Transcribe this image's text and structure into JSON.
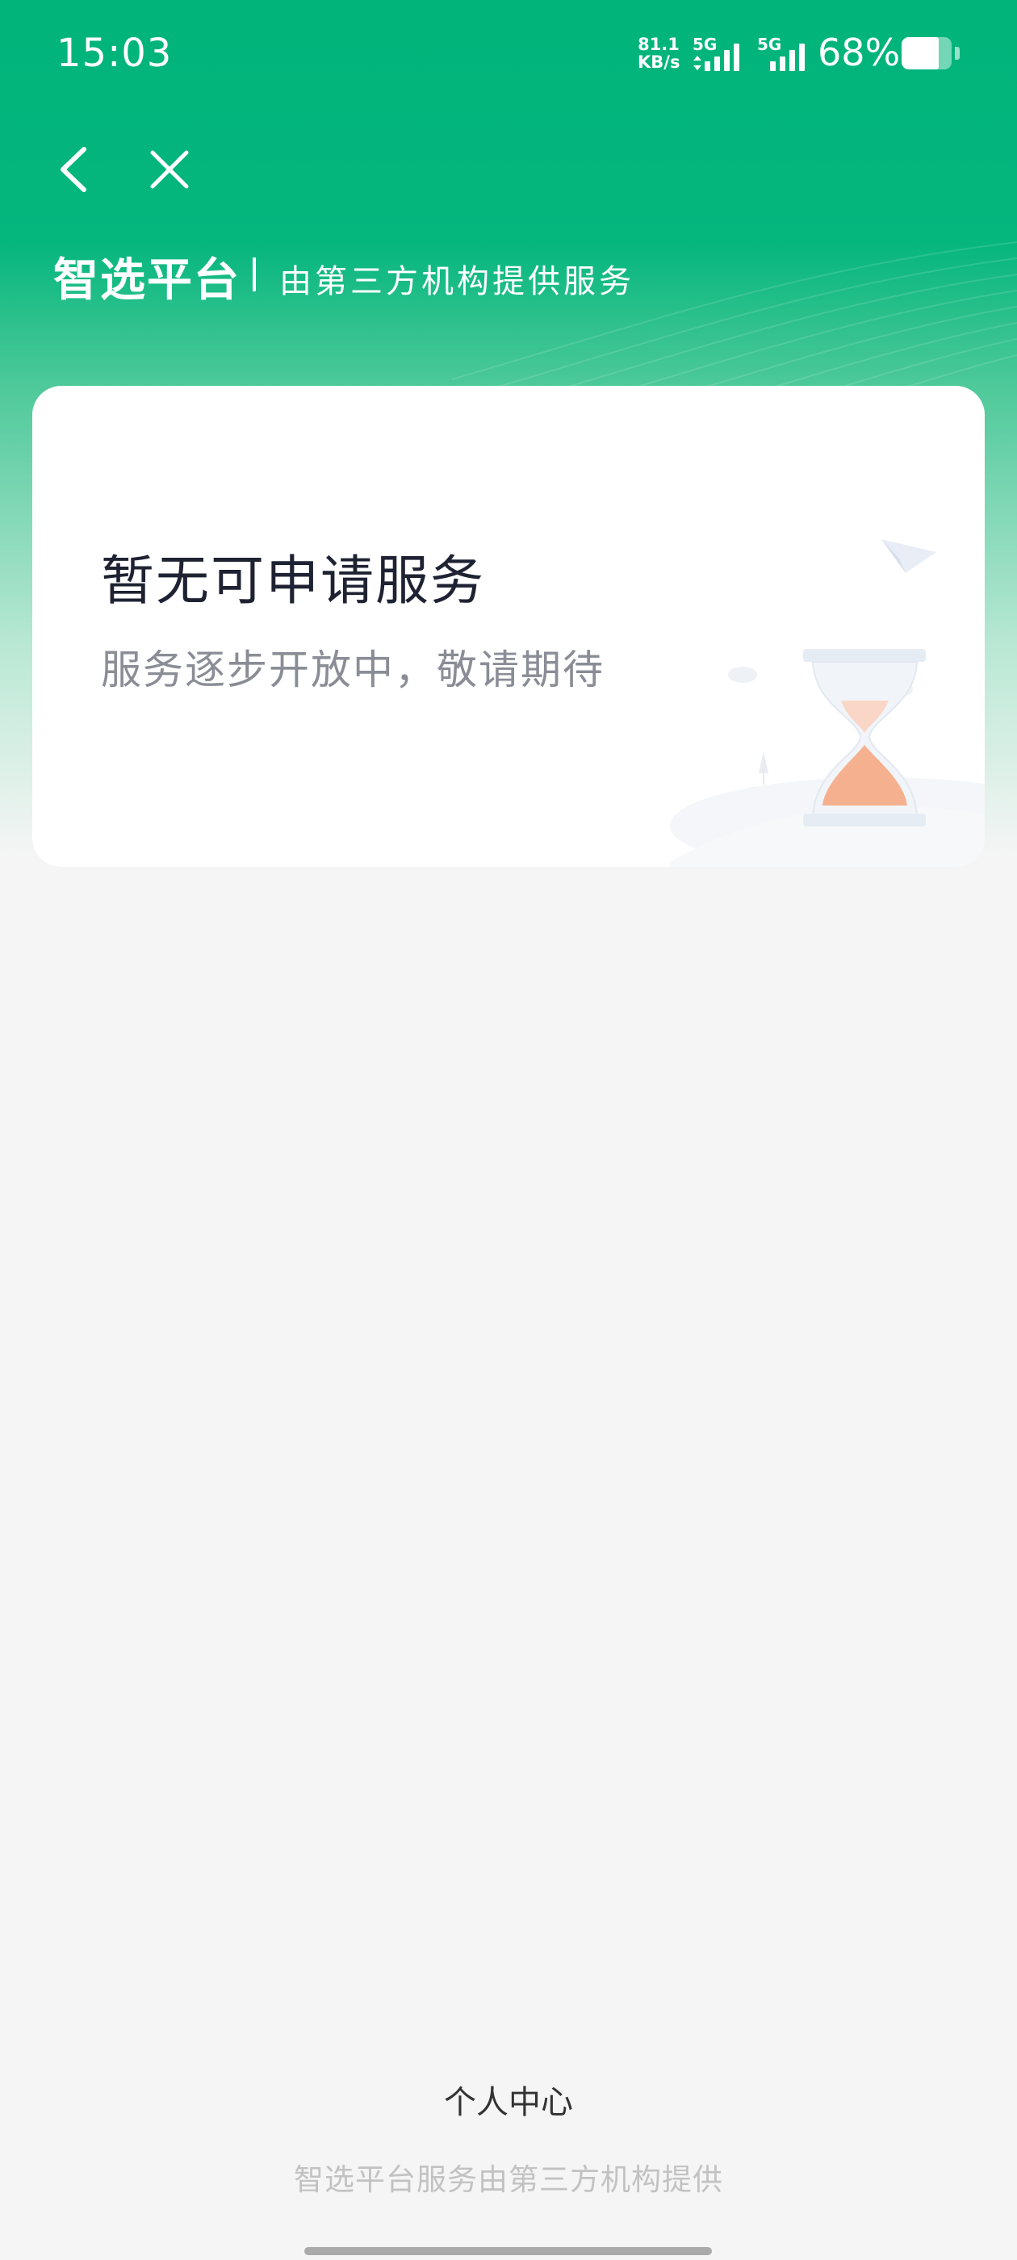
{
  "status_bar": {
    "time": "15:03",
    "net_speed_value": "81.1",
    "net_speed_unit": "KB/s",
    "sim1_label": "5G",
    "sim2_label": "5G",
    "battery_percent": "68%",
    "battery_level": 0.68
  },
  "header": {
    "brand_title": "智选平台",
    "brand_subtitle": "由第三方机构提供服务",
    "back_icon": "chevron-left-icon",
    "close_icon": "close-icon"
  },
  "empty_state": {
    "title": "暂无可申请服务",
    "subtitle": "服务逐步开放中，敬请期待",
    "illustration": "hourglass-illustration"
  },
  "footer": {
    "link_label": "个人中心",
    "note": "智选平台服务由第三方机构提供"
  },
  "colors": {
    "brand_green": "#00b47a",
    "page_bg": "#f5f5f5",
    "card_bg": "#ffffff",
    "title_text": "#1e2232",
    "muted_text": "#8a8d96",
    "hourglass_sand": "#f5b18f"
  }
}
